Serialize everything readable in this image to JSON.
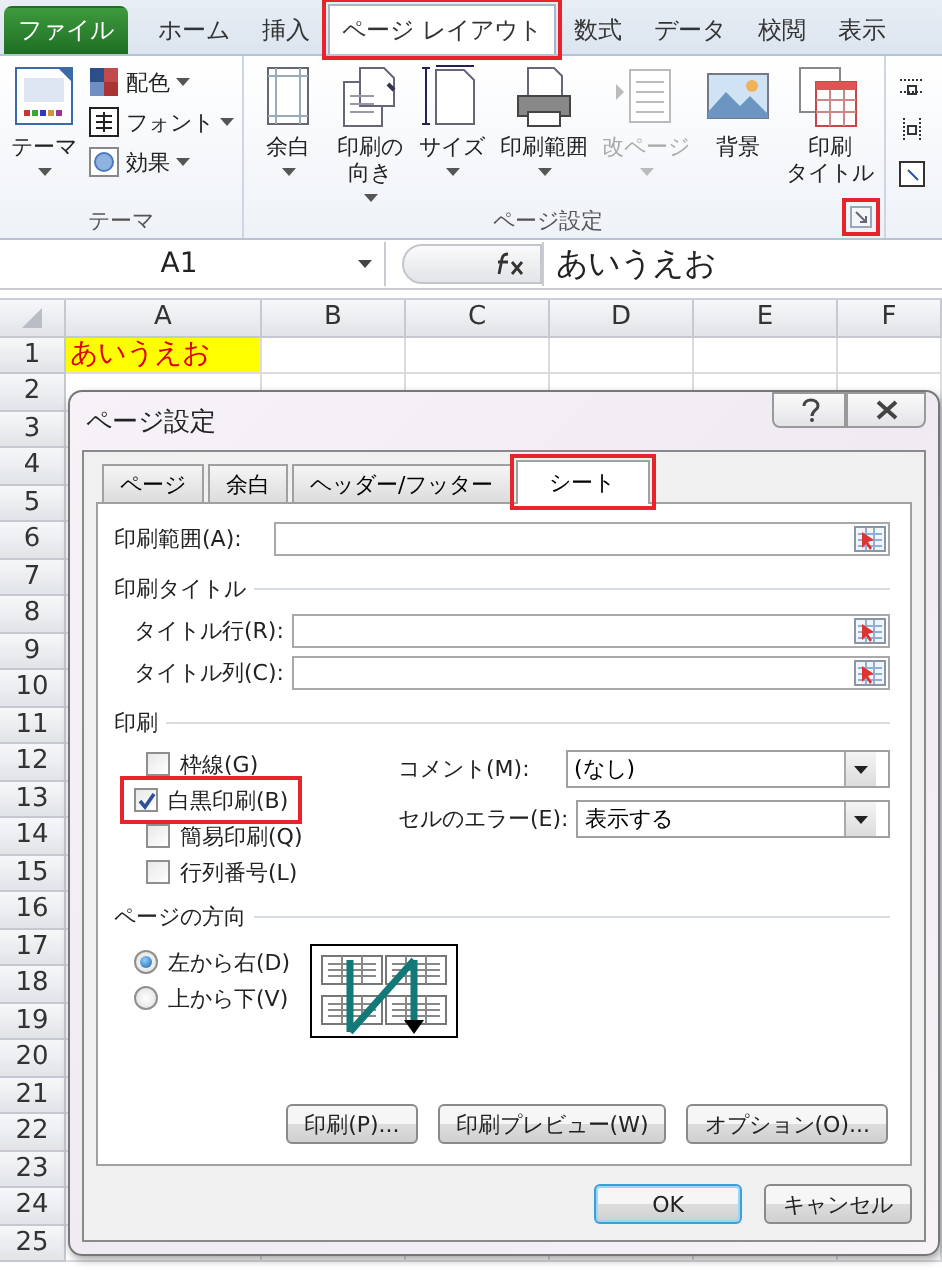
{
  "ribbon": {
    "tabs": [
      {
        "label": "ファイル",
        "kind": "file",
        "selected": false,
        "highlighted": false
      },
      {
        "label": "ホーム",
        "kind": "tab",
        "selected": false,
        "highlighted": false
      },
      {
        "label": "挿入",
        "kind": "tab",
        "selected": false,
        "highlighted": false
      },
      {
        "label": "ページ レイアウト",
        "kind": "tab",
        "selected": true,
        "highlighted": true
      },
      {
        "label": "数式",
        "kind": "tab",
        "selected": false,
        "highlighted": false
      },
      {
        "label": "データ",
        "kind": "tab",
        "selected": false,
        "highlighted": false
      },
      {
        "label": "校閲",
        "kind": "tab",
        "selected": false,
        "highlighted": false
      },
      {
        "label": "表示",
        "kind": "tab",
        "selected": false,
        "highlighted": false
      }
    ],
    "groups": [
      {
        "label": "テーマ",
        "items": [
          {
            "label": "テーマ",
            "kind": "large",
            "dropdown": true,
            "disabled": false
          },
          {
            "label": "配色",
            "kind": "small",
            "dropdown": true,
            "disabled": false
          },
          {
            "label": "フォント",
            "kind": "small",
            "dropdown": true,
            "disabled": false
          },
          {
            "label": "効果",
            "kind": "small",
            "dropdown": true,
            "disabled": false
          }
        ]
      },
      {
        "label": "ページ設定",
        "launcher": true,
        "launcher_highlighted": true,
        "items": [
          {
            "label": "余白",
            "kind": "large",
            "dropdown": true,
            "disabled": false
          },
          {
            "lines": [
              "印刷の",
              "向き"
            ],
            "kind": "large",
            "dropdown": true,
            "disabled": false
          },
          {
            "label": "サイズ",
            "kind": "large",
            "dropdown": true,
            "disabled": false
          },
          {
            "label": "印刷範囲",
            "kind": "large",
            "dropdown": true,
            "disabled": false
          },
          {
            "label": "改ページ",
            "kind": "large",
            "dropdown": true,
            "disabled": true
          },
          {
            "label": "背景",
            "kind": "large",
            "dropdown": false,
            "disabled": false
          },
          {
            "lines": [
              "印刷",
              "タイトル"
            ],
            "kind": "large",
            "dropdown": false,
            "disabled": false
          }
        ]
      }
    ]
  },
  "formula_bar": {
    "name_box": "A1",
    "value": "あいうえお"
  },
  "sheet": {
    "columns": [
      "A",
      "B",
      "C",
      "D",
      "E",
      "F"
    ],
    "rows": [
      {
        "header": "1",
        "cells": [
          {
            "text": "あいうえお",
            "highlighted": true
          }
        ]
      },
      {
        "header": "2"
      },
      {
        "header": "3"
      },
      {
        "header": "4"
      },
      {
        "header": "5"
      },
      {
        "header": "6"
      },
      {
        "header": "7"
      },
      {
        "header": "8"
      },
      {
        "header": "9"
      },
      {
        "header": "10"
      },
      {
        "header": "11"
      },
      {
        "header": "12"
      },
      {
        "header": "13"
      },
      {
        "header": "14"
      },
      {
        "header": "15"
      },
      {
        "header": "16"
      },
      {
        "header": "17"
      },
      {
        "header": "18"
      },
      {
        "header": "19"
      },
      {
        "header": "20"
      },
      {
        "header": "21"
      },
      {
        "header": "22"
      },
      {
        "header": "23"
      },
      {
        "header": "24"
      },
      {
        "header": "25"
      }
    ]
  },
  "dialog": {
    "title": "ページ設定",
    "tabs": [
      {
        "label": "ページ",
        "selected": false,
        "highlighted": false
      },
      {
        "label": "余白",
        "selected": false,
        "highlighted": false
      },
      {
        "label": "ヘッダー/フッター",
        "selected": false,
        "highlighted": false
      },
      {
        "label": "シート",
        "selected": true,
        "highlighted": true
      }
    ],
    "print_area": {
      "label": "印刷範囲(A):"
    },
    "print_titles": {
      "heading": "印刷タイトル",
      "fields": [
        {
          "label": "タイトル行(R):"
        },
        {
          "label": "タイトル列(C):"
        }
      ]
    },
    "print": {
      "heading": "印刷",
      "checkboxes": [
        {
          "label": "枠線(G)",
          "checked": false,
          "highlighted": false
        },
        {
          "label": "白黒印刷(B)",
          "checked": true,
          "highlighted": true
        },
        {
          "label": "簡易印刷(Q)",
          "checked": false,
          "highlighted": false
        },
        {
          "label": "行列番号(L)",
          "checked": false,
          "highlighted": false
        }
      ],
      "dropdowns": [
        {
          "label": "コメント(M):",
          "value": "(なし)"
        },
        {
          "label": "セルのエラー(E):",
          "value": "表示する"
        }
      ]
    },
    "page_order": {
      "heading": "ページの方向",
      "options": [
        {
          "label": "左から右(D)",
          "selected": true
        },
        {
          "label": "上から下(V)",
          "selected": false
        }
      ]
    },
    "panel_buttons": [
      "印刷(P)...",
      "印刷プレビュー(W)",
      "オプション(O)..."
    ],
    "buttons": [
      {
        "label": "OK",
        "default": true
      },
      {
        "label": "キャンセル",
        "default": false
      }
    ]
  }
}
